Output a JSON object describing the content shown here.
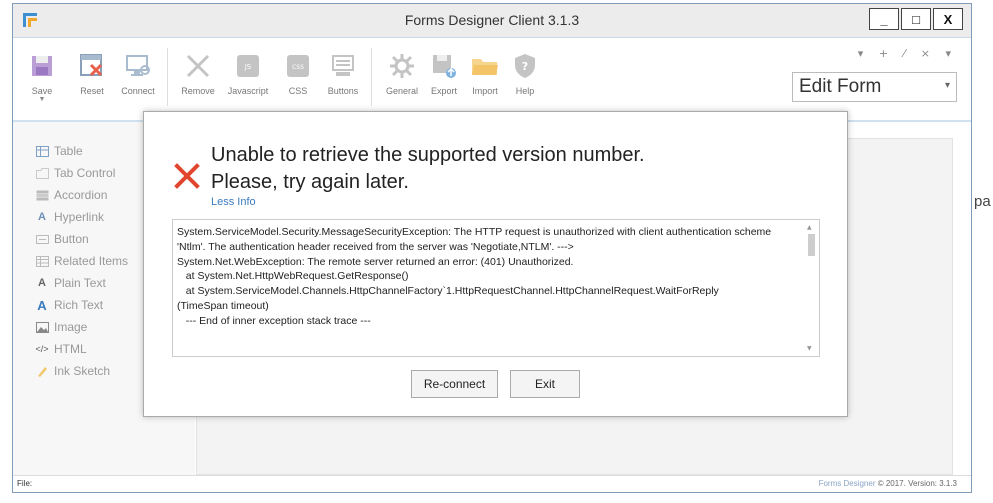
{
  "window": {
    "title": "Forms Designer Client 3.1.3",
    "controls": [
      "_",
      "□",
      "X"
    ]
  },
  "toolbar": {
    "items": [
      {
        "label": "Save",
        "icon": "save-icon"
      },
      {
        "label": "Reset",
        "icon": "reset-icon"
      },
      {
        "label": "Connect",
        "icon": "connect-icon"
      },
      {
        "label": "Remove",
        "icon": "remove-icon"
      },
      {
        "label": "Javascript",
        "icon": "javascript-icon"
      },
      {
        "label": "CSS",
        "icon": "css-icon"
      },
      {
        "label": "Buttons",
        "icon": "buttons-icon"
      },
      {
        "label": "General",
        "icon": "general-icon"
      },
      {
        "label": "Export",
        "icon": "export-icon"
      },
      {
        "label": "Import",
        "icon": "import-icon"
      },
      {
        "label": "Help",
        "icon": "help-icon"
      }
    ],
    "mini_tools": "▾ + ⁄ × ▾",
    "mode_select": "Edit Form"
  },
  "sidebar": {
    "items": [
      {
        "label": "Table",
        "icon": "table-icon"
      },
      {
        "label": "Tab Control",
        "icon": "tab-control-icon"
      },
      {
        "label": "Accordion",
        "icon": "accordion-icon"
      },
      {
        "label": "Hyperlink",
        "icon": "hyperlink-icon"
      },
      {
        "label": "Button",
        "icon": "button-icon"
      },
      {
        "label": "Related Items",
        "icon": "related-items-icon"
      },
      {
        "label": "Plain Text",
        "icon": "plain-text-icon"
      },
      {
        "label": "Rich Text",
        "icon": "rich-text-icon"
      },
      {
        "label": "Image",
        "icon": "image-icon"
      },
      {
        "label": "HTML",
        "icon": "html-icon"
      },
      {
        "label": "Ink Sketch",
        "icon": "ink-sketch-icon"
      }
    ]
  },
  "dialog": {
    "line1": "Unable to retrieve the supported version number.",
    "line2": "Please, try again later.",
    "less_info": "Less Info",
    "details": "System.ServiceModel.Security.MessageSecurityException: The HTTP request is unauthorized with client authentication scheme 'Ntlm'. The authentication header received from the server was 'Negotiate,NTLM'. --->\nSystem.Net.WebException: The remote server returned an error: (401) Unauthorized.\n   at System.Net.HttpWebRequest.GetResponse()\n   at System.ServiceModel.Channels.HttpChannelFactory`1.HttpRequestChannel.HttpChannelRequest.WaitForReply\n(TimeSpan timeout)\n   --- End of inner exception stack trace ---",
    "reconnect_label": "Re-connect",
    "exit_label": "Exit"
  },
  "status": {
    "left": "File:",
    "brand": "Forms Designer",
    "right": "© 2017. Version: 3.1.3"
  },
  "edge_text": "pa"
}
